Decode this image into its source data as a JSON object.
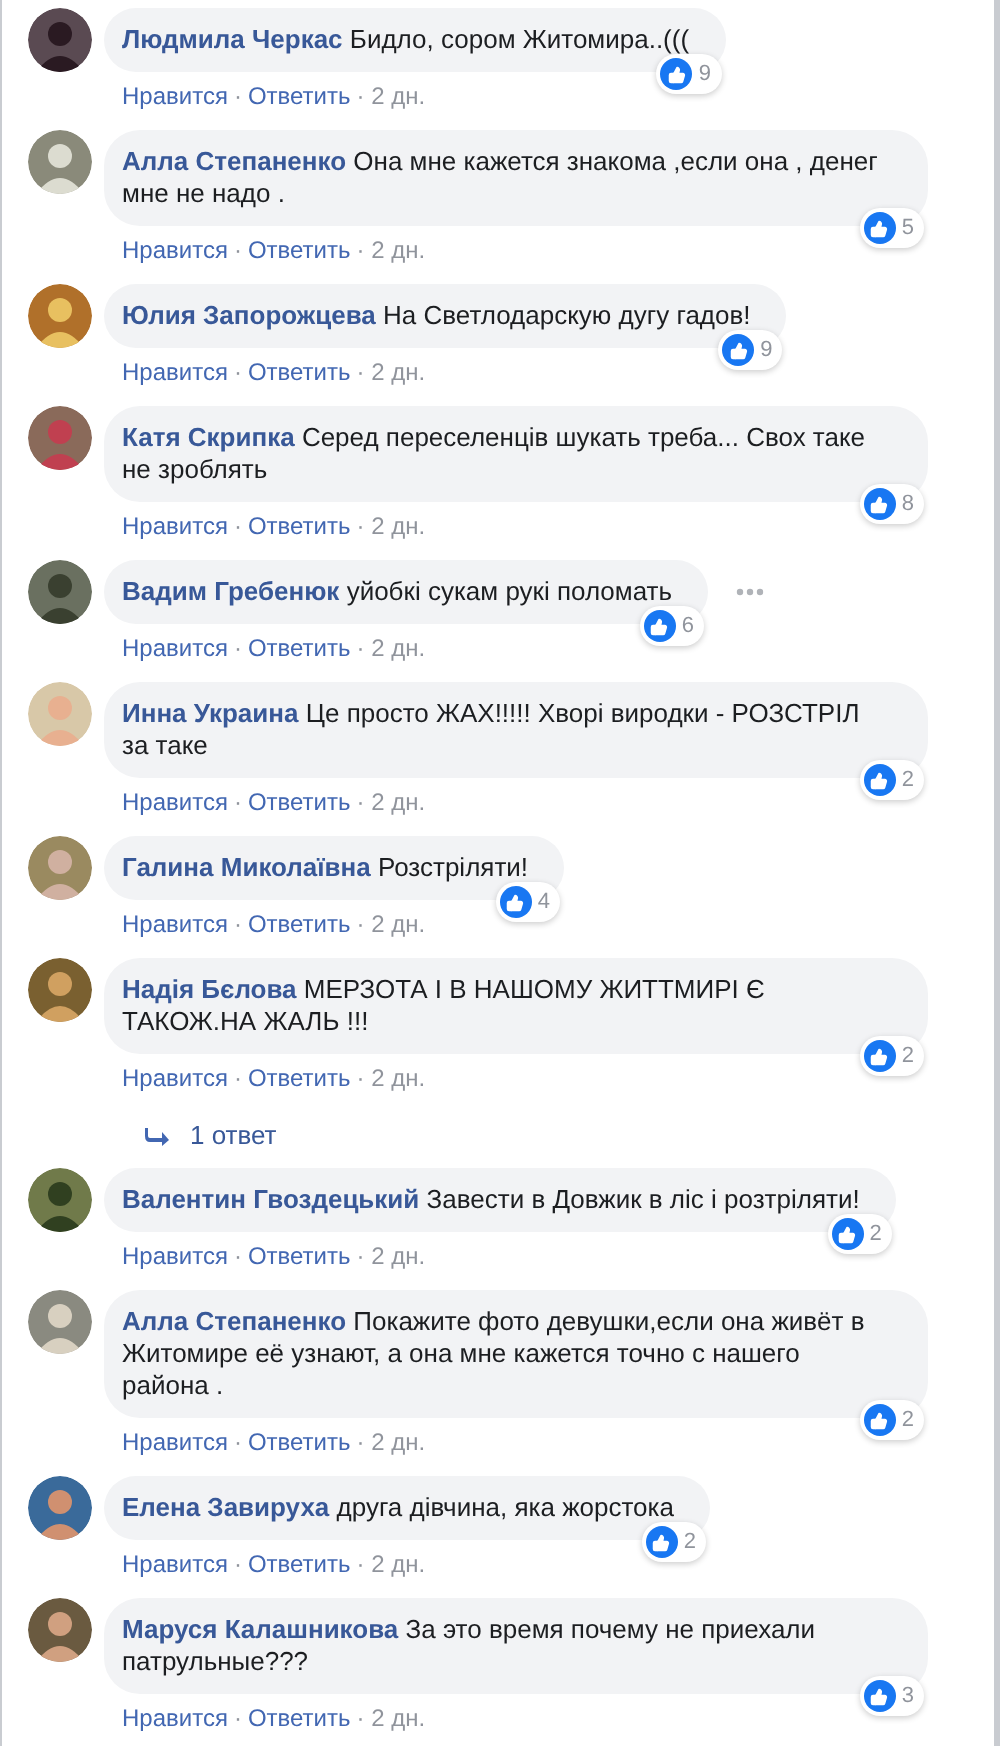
{
  "comments": [
    {
      "author": "Людмила Черкас",
      "text": "Бидло, сором Житомира..(((",
      "reactions": "9",
      "like": "Нравится",
      "sep": "·",
      "reply": "Ответить",
      "time": "· 2 дн.",
      "more_button": false
    },
    {
      "author": "Алла Степаненко",
      "text": "Она мне кажется знакома ,если она , денег мне не надо .",
      "reactions": "5",
      "like": "Нравится",
      "sep": "·",
      "reply": "Ответить",
      "time": "· 2 дн.",
      "more_button": false
    },
    {
      "author": "Юлия Запорожцева",
      "text": "На Светлодарскую дугу гадов!",
      "reactions": "9",
      "like": "Нравится",
      "sep": "·",
      "reply": "Ответить",
      "time": "· 2 дн.",
      "more_button": false
    },
    {
      "author": "Катя Скрипка",
      "text": "Серед переселенців шукать треба... Свох таке не зроблять",
      "reactions": "8",
      "like": "Нравится",
      "sep": "·",
      "reply": "Ответить",
      "time": "· 2 дн.",
      "more_button": false
    },
    {
      "author": "Вадим Гребенюк",
      "text": "уйобкі сукам рукі поломать",
      "reactions": "6",
      "like": "Нравится",
      "sep": "·",
      "reply": "Ответить",
      "time": "· 2 дн.",
      "more_button": true
    },
    {
      "author": "Инна Украина",
      "text": "Це просто ЖАХ!!!!! Хворі виродки - РОЗСТРІЛ за таке",
      "reactions": "2",
      "like": "Нравится",
      "sep": "·",
      "reply": "Ответить",
      "time": "· 2 дн.",
      "more_button": false
    },
    {
      "author": "Галина Миколаївна",
      "text": "Розстріляти!",
      "reactions": "4",
      "like": "Нравится",
      "sep": "·",
      "reply": "Ответить",
      "time": "· 2 дн.",
      "more_button": false
    },
    {
      "author": "Надія Бєлова",
      "text": "МЕРЗОТА І В НАШОМУ ЖИТТМИРІ Є ТАКОЖ.НА ЖАЛЬ !!!",
      "reactions": "2",
      "like": "Нравится",
      "sep": "·",
      "reply": "Ответить",
      "time": "· 2 дн.",
      "more_button": false,
      "replies_link": "1 ответ"
    },
    {
      "author": "Валентин Гвоздецький",
      "text": "Завести в Довжик в ліс і розтріляти!",
      "reactions": "2",
      "like": "Нравится",
      "sep": "·",
      "reply": "Ответить",
      "time": "· 2 дн.",
      "more_button": false
    },
    {
      "author": "Алла Степаненко",
      "text": "Покажите фото девушки,если она живёт в Житомире её узнают, а она мне кажется точно с нашего района .",
      "reactions": "2",
      "like": "Нравится",
      "sep": "·",
      "reply": "Ответить",
      "time": "· 2 дн.",
      "more_button": false
    },
    {
      "author": "Елена Завируха",
      "text": "друга дівчина, яка жорстока",
      "reactions": "2",
      "like": "Нравится",
      "sep": "·",
      "reply": "Ответить",
      "time": "· 2 дн.",
      "more_button": false
    },
    {
      "author": "Маруся Калашникова",
      "text": "За это время почему не приехали патрульные???",
      "reactions": "3",
      "like": "Нравится",
      "sep": "·",
      "reply": "Ответить",
      "time": "· 2 дн.",
      "more_button": false
    }
  ]
}
